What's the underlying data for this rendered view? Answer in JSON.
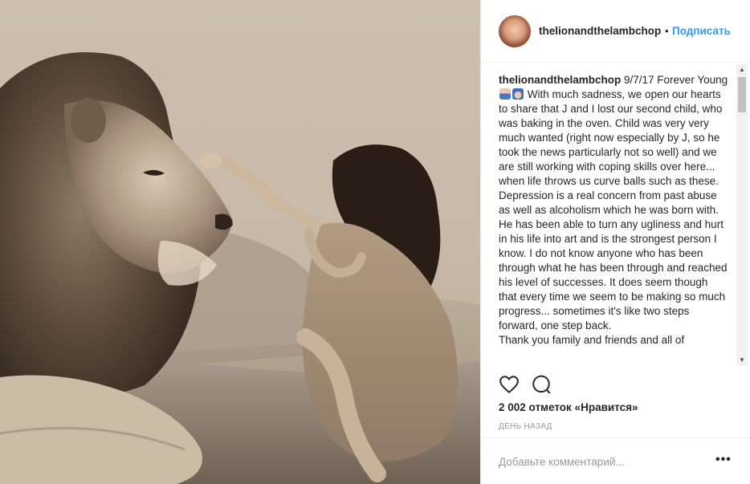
{
  "post": {
    "username": "thelionandthelambchop",
    "separator": "•",
    "follow_label": "Подписать",
    "caption_username": "thelionandthelambchop",
    "caption_part1": " 9/7/17 Forever Young ",
    "caption_part2": " With much sadness, we open our hearts to share that J and I lost our second child, who was baking in the oven. Child was very very much wanted (right now especially by J, so he took the news particularly not so well) and we are still working with coping skills over here... when life throws us curve balls such as these. Depression is a real concern from past abuse as well as alcoholism which he was born with. He has been able to turn any ugliness and hurt in his life into art and is the strongest person I know. I do not know anyone who has been through what he has been through and reached his level of successes. It does seem though that every time we seem to be making so much progress... sometimes it's like two steps forward, one step back.",
    "caption_cutoff_line": "Thank you family and friends and all of",
    "likes": "2 002 отметок «Нравится»",
    "time": "ДЕНЬ НАЗАД",
    "comment_placeholder": "Добавьте комментарий...",
    "more_label": "•••"
  },
  "icons": {
    "like": "heart-icon",
    "comment": "comment-bubble-icon",
    "emoji1": "person-emoji",
    "emoji2": "angel-emoji"
  }
}
